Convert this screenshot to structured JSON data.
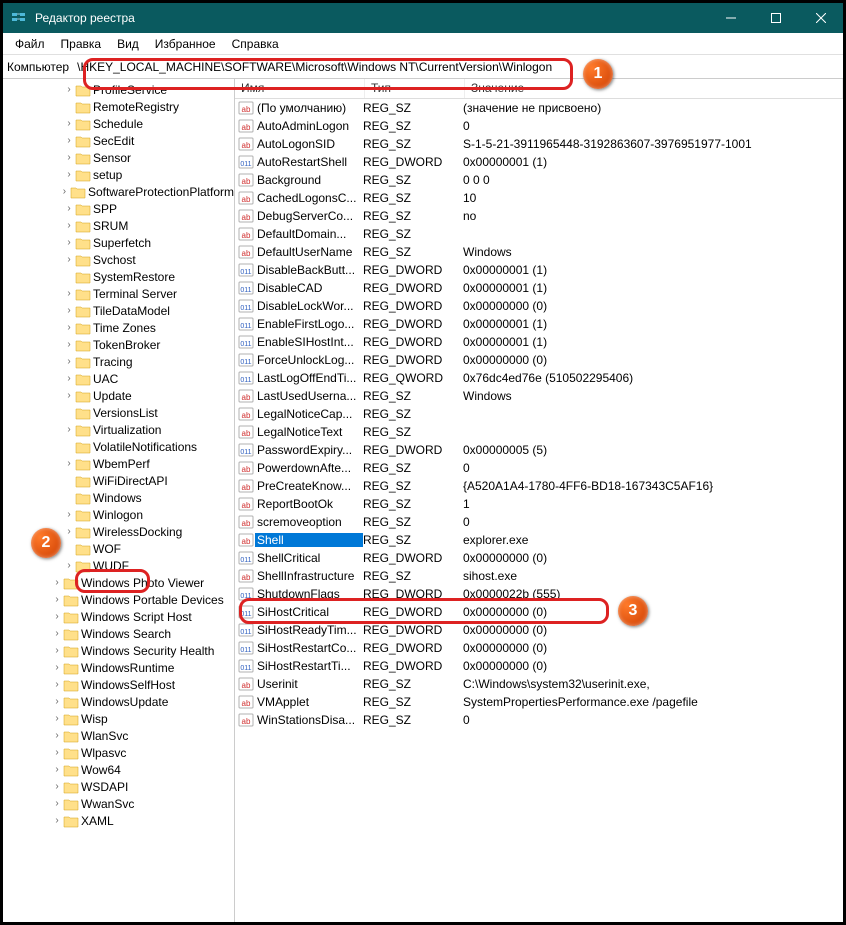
{
  "window": {
    "title": "Редактор реестра"
  },
  "menu": {
    "file": "Файл",
    "edit": "Правка",
    "view": "Вид",
    "fav": "Избранное",
    "help": "Справка"
  },
  "address": {
    "label": "Компьютер",
    "path": "\\HKEY_LOCAL_MACHINE\\SOFTWARE\\Microsoft\\Windows NT\\CurrentVersion\\Winlogon"
  },
  "columns": {
    "name": "Имя",
    "type": "Тип",
    "value": "Значение"
  },
  "tree": [
    {
      "label": "ProfileService",
      "level": 5,
      "exp": ">"
    },
    {
      "label": "RemoteRegistry",
      "level": 5,
      "exp": ""
    },
    {
      "label": "Schedule",
      "level": 5,
      "exp": ">"
    },
    {
      "label": "SecEdit",
      "level": 5,
      "exp": ">"
    },
    {
      "label": "Sensor",
      "level": 5,
      "exp": ">"
    },
    {
      "label": "setup",
      "level": 5,
      "exp": ">"
    },
    {
      "label": "SoftwareProtectionPlatform",
      "level": 5,
      "exp": ">"
    },
    {
      "label": "SPP",
      "level": 5,
      "exp": ">"
    },
    {
      "label": "SRUM",
      "level": 5,
      "exp": ">"
    },
    {
      "label": "Superfetch",
      "level": 5,
      "exp": ">"
    },
    {
      "label": "Svchost",
      "level": 5,
      "exp": ">"
    },
    {
      "label": "SystemRestore",
      "level": 5,
      "exp": ""
    },
    {
      "label": "Terminal Server",
      "level": 5,
      "exp": ">"
    },
    {
      "label": "TileDataModel",
      "level": 5,
      "exp": ">"
    },
    {
      "label": "Time Zones",
      "level": 5,
      "exp": ">"
    },
    {
      "label": "TokenBroker",
      "level": 5,
      "exp": ">"
    },
    {
      "label": "Tracing",
      "level": 5,
      "exp": ">"
    },
    {
      "label": "UAC",
      "level": 5,
      "exp": ">"
    },
    {
      "label": "Update",
      "level": 5,
      "exp": ">"
    },
    {
      "label": "VersionsList",
      "level": 5,
      "exp": ""
    },
    {
      "label": "Virtualization",
      "level": 5,
      "exp": ">"
    },
    {
      "label": "VolatileNotifications",
      "level": 5,
      "exp": ""
    },
    {
      "label": "WbemPerf",
      "level": 5,
      "exp": ">"
    },
    {
      "label": "WiFiDirectAPI",
      "level": 5,
      "exp": ""
    },
    {
      "label": "Windows",
      "level": 5,
      "exp": ""
    },
    {
      "label": "Winlogon",
      "level": 5,
      "exp": ">",
      "selected": true
    },
    {
      "label": "WirelessDocking",
      "level": 5,
      "exp": ">"
    },
    {
      "label": "WOF",
      "level": 5,
      "exp": ""
    },
    {
      "label": "WUDF",
      "level": 5,
      "exp": ">"
    },
    {
      "label": "Windows Photo Viewer",
      "level": 4,
      "exp": ">"
    },
    {
      "label": "Windows Portable Devices",
      "level": 4,
      "exp": ">"
    },
    {
      "label": "Windows Script Host",
      "level": 4,
      "exp": ">"
    },
    {
      "label": "Windows Search",
      "level": 4,
      "exp": ">"
    },
    {
      "label": "Windows Security Health",
      "level": 4,
      "exp": ">"
    },
    {
      "label": "WindowsRuntime",
      "level": 4,
      "exp": ">"
    },
    {
      "label": "WindowsSelfHost",
      "level": 4,
      "exp": ">"
    },
    {
      "label": "WindowsUpdate",
      "level": 4,
      "exp": ">"
    },
    {
      "label": "Wisp",
      "level": 4,
      "exp": ">"
    },
    {
      "label": "WlanSvc",
      "level": 4,
      "exp": ">"
    },
    {
      "label": "Wlpasvc",
      "level": 4,
      "exp": ">"
    },
    {
      "label": "Wow64",
      "level": 4,
      "exp": ">"
    },
    {
      "label": "WSDAPI",
      "level": 4,
      "exp": ">"
    },
    {
      "label": "WwanSvc",
      "level": 4,
      "exp": ">"
    },
    {
      "label": "XAML",
      "level": 4,
      "exp": ">"
    }
  ],
  "rows": [
    {
      "icon": "str",
      "name": "(По умолчанию)",
      "type": "REG_SZ",
      "value": "(значение не присвоено)"
    },
    {
      "icon": "str",
      "name": "AutoAdminLogon",
      "type": "REG_SZ",
      "value": "0"
    },
    {
      "icon": "str",
      "name": "AutoLogonSID",
      "type": "REG_SZ",
      "value": "S-1-5-21-3911965448-3192863607-3976951977-1001"
    },
    {
      "icon": "bin",
      "name": "AutoRestartShell",
      "type": "REG_DWORD",
      "value": "0x00000001 (1)"
    },
    {
      "icon": "str",
      "name": "Background",
      "type": "REG_SZ",
      "value": "0 0 0"
    },
    {
      "icon": "str",
      "name": "CachedLogonsC...",
      "type": "REG_SZ",
      "value": "10"
    },
    {
      "icon": "str",
      "name": "DebugServerCo...",
      "type": "REG_SZ",
      "value": "no"
    },
    {
      "icon": "str",
      "name": "DefaultDomain...",
      "type": "REG_SZ",
      "value": ""
    },
    {
      "icon": "str",
      "name": "DefaultUserName",
      "type": "REG_SZ",
      "value": "Windows"
    },
    {
      "icon": "bin",
      "name": "DisableBackButt...",
      "type": "REG_DWORD",
      "value": "0x00000001 (1)"
    },
    {
      "icon": "bin",
      "name": "DisableCAD",
      "type": "REG_DWORD",
      "value": "0x00000001 (1)"
    },
    {
      "icon": "bin",
      "name": "DisableLockWor...",
      "type": "REG_DWORD",
      "value": "0x00000000 (0)"
    },
    {
      "icon": "bin",
      "name": "EnableFirstLogo...",
      "type": "REG_DWORD",
      "value": "0x00000001 (1)"
    },
    {
      "icon": "bin",
      "name": "EnableSIHostInt...",
      "type": "REG_DWORD",
      "value": "0x00000001 (1)"
    },
    {
      "icon": "bin",
      "name": "ForceUnlockLog...",
      "type": "REG_DWORD",
      "value": "0x00000000 (0)"
    },
    {
      "icon": "bin",
      "name": "LastLogOffEndTi...",
      "type": "REG_QWORD",
      "value": "0x76dc4ed76e (510502295406)"
    },
    {
      "icon": "str",
      "name": "LastUsedUserna...",
      "type": "REG_SZ",
      "value": "Windows"
    },
    {
      "icon": "str",
      "name": "LegalNoticeCap...",
      "type": "REG_SZ",
      "value": ""
    },
    {
      "icon": "str",
      "name": "LegalNoticeText",
      "type": "REG_SZ",
      "value": ""
    },
    {
      "icon": "bin",
      "name": "PasswordExpiry...",
      "type": "REG_DWORD",
      "value": "0x00000005 (5)"
    },
    {
      "icon": "str",
      "name": "PowerdownAfte...",
      "type": "REG_SZ",
      "value": "0"
    },
    {
      "icon": "str",
      "name": "PreCreateKnow...",
      "type": "REG_SZ",
      "value": "{A520A1A4-1780-4FF6-BD18-167343C5AF16}"
    },
    {
      "icon": "str",
      "name": "ReportBootOk",
      "type": "REG_SZ",
      "value": "1"
    },
    {
      "icon": "str",
      "name": "scremoveoption",
      "type": "REG_SZ",
      "value": "0"
    },
    {
      "icon": "str",
      "name": "Shell",
      "type": "REG_SZ",
      "value": "explorer.exe",
      "selected": true
    },
    {
      "icon": "bin",
      "name": "ShellCritical",
      "type": "REG_DWORD",
      "value": "0x00000000 (0)"
    },
    {
      "icon": "str",
      "name": "ShellInfrastructure",
      "type": "REG_SZ",
      "value": "sihost.exe"
    },
    {
      "icon": "bin",
      "name": "ShutdownFlags",
      "type": "REG_DWORD",
      "value": "0x0000022b (555)"
    },
    {
      "icon": "bin",
      "name": "SiHostCritical",
      "type": "REG_DWORD",
      "value": "0x00000000 (0)"
    },
    {
      "icon": "bin",
      "name": "SiHostReadyTim...",
      "type": "REG_DWORD",
      "value": "0x00000000 (0)"
    },
    {
      "icon": "bin",
      "name": "SiHostRestartCo...",
      "type": "REG_DWORD",
      "value": "0x00000000 (0)"
    },
    {
      "icon": "bin",
      "name": "SiHostRestartTi...",
      "type": "REG_DWORD",
      "value": "0x00000000 (0)"
    },
    {
      "icon": "str",
      "name": "Userinit",
      "type": "REG_SZ",
      "value": "C:\\Windows\\system32\\userinit.exe,"
    },
    {
      "icon": "str",
      "name": "VMApplet",
      "type": "REG_SZ",
      "value": "SystemPropertiesPerformance.exe /pagefile"
    },
    {
      "icon": "str",
      "name": "WinStationsDisa...",
      "type": "REG_SZ",
      "value": "0"
    }
  ],
  "badges": {
    "one": "1",
    "two": "2",
    "three": "3"
  }
}
